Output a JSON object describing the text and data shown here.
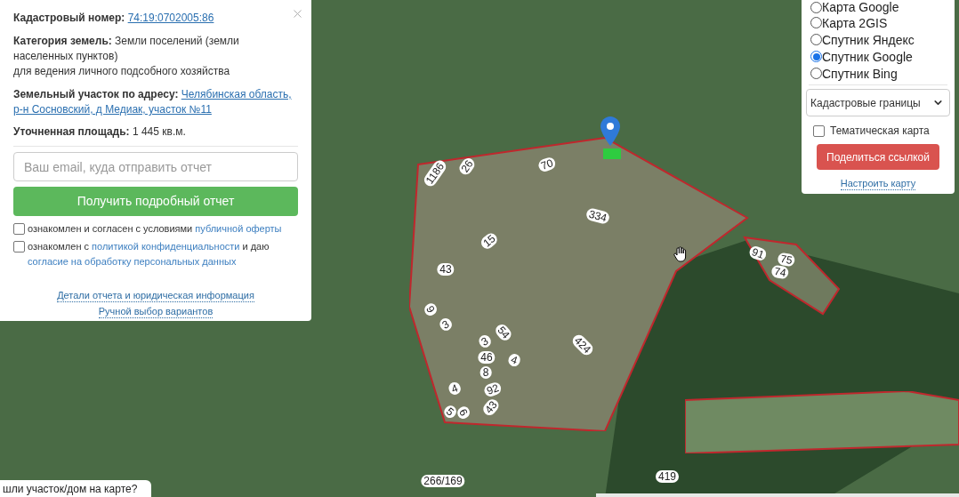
{
  "info_card": {
    "cadastral_number": {
      "label": "Кадастровый номер:",
      "value": "74:19:0702005:86"
    },
    "land_category": {
      "text": "**Категория земель:** Земли поселений (земли населенных пунктов)",
      "purpose": "для ведения личного подсобного хозяйства"
    },
    "address": {
      "label": "Земельный участок по адресу:",
      "lines": [
        "Челябинская область,",
        "р-н Сосновский, д Медиак, участок №11"
      ]
    },
    "area": {
      "text": "**Уточненная площадь:** 1 445 кв.м."
    },
    "email_field": {
      "placeholder": "Ваш email, куда отправить отчет"
    },
    "report_button": "Получить подробный отчет",
    "consents": [
      {
        "checked": false,
        "parts": [
          {
            "kind": "text",
            "text": "ознакомлен и согласен с условиями "
          },
          {
            "kind": "link",
            "text": "публичной оферты"
          }
        ]
      },
      {
        "checked": false,
        "parts": [
          {
            "kind": "text",
            "text": "ознакомлен с "
          },
          {
            "kind": "link",
            "text": "политикой конфиденциальности"
          },
          {
            "kind": "text",
            "text": " и даю "
          },
          {
            "kind": "link",
            "text": "согласие на обработку персональных данных"
          }
        ]
      }
    ],
    "links": [
      "Детали отчета и юридическая информация",
      "Ручной выбор вариантов"
    ]
  },
  "map_layers": {
    "options": [
      {
        "label": "Карта Google",
        "selected": false
      },
      {
        "label": "Карта 2GIS",
        "selected": false
      },
      {
        "label": "Спутник Яндекс",
        "selected": false
      },
      {
        "label": "Спутник Google",
        "selected": true
      },
      {
        "label": "Спутник Bing",
        "selected": false
      }
    ],
    "overlay_select": {
      "value": "Кадастровые границы"
    },
    "thematic_map": {
      "label": "Тематическая карта",
      "checked": false
    },
    "share_button": "Поделиться ссылкой",
    "settings_link": "Настроить карту"
  },
  "map": {
    "parcel_labels": [
      "1186",
      "26",
      "70",
      "334",
      "15",
      "43",
      "9",
      "3",
      "54",
      "3",
      "46",
      "4",
      "8",
      "4",
      "92",
      "5",
      "6",
      "43",
      "424",
      "419",
      "266/169",
      "91",
      "75",
      "74"
    ]
  },
  "bottom_prompt": {
    "text": "шли участок/дом на карте?"
  }
}
